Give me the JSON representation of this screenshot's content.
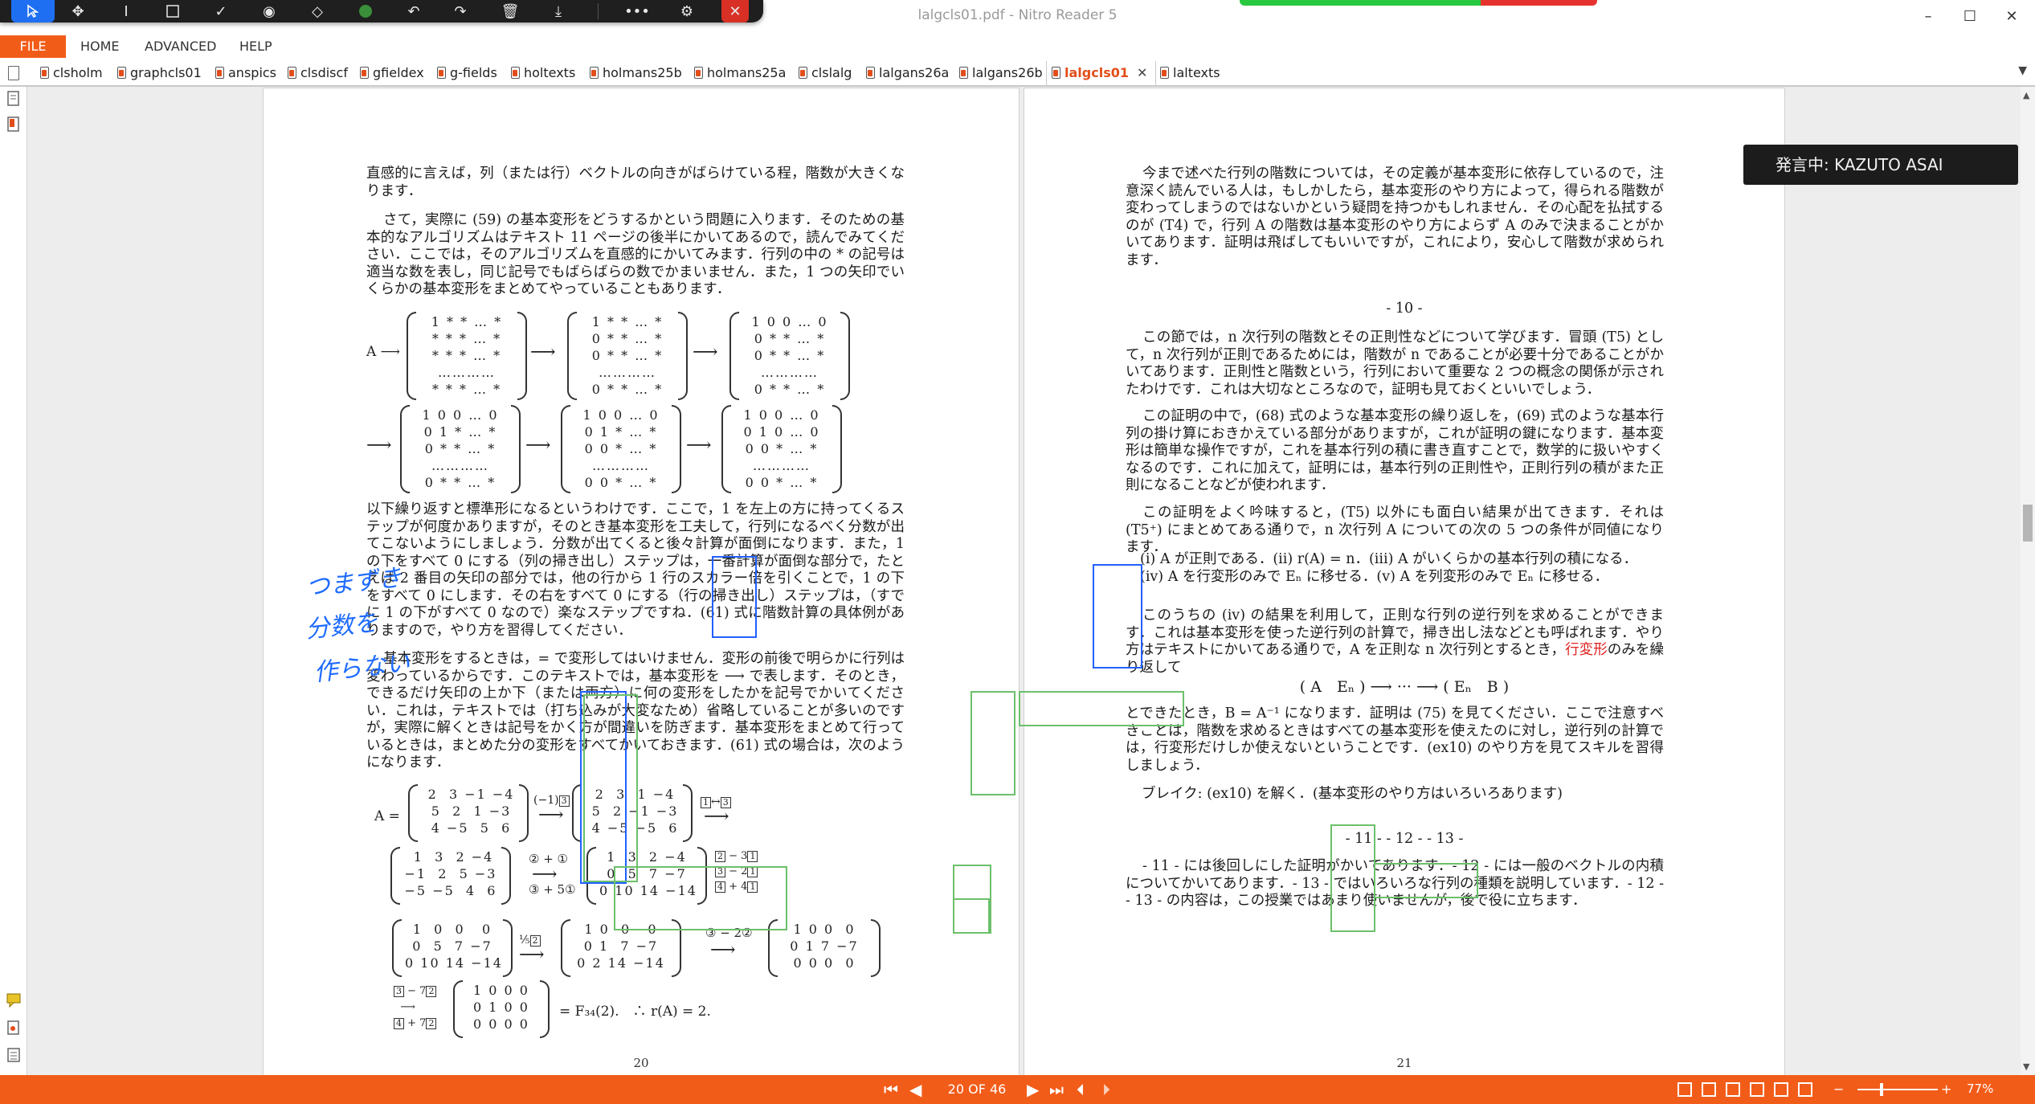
{
  "window": {
    "title": "lalgcls01.pdf - Nitro Reader 5",
    "minimize": "–",
    "maximize": "☐",
    "close": "✕"
  },
  "annotation_toolbar": {
    "tools": [
      "select-pointer",
      "move",
      "text-cursor",
      "rectangle",
      "checkmark",
      "stamp",
      "eraser",
      "color-dot",
      "undo",
      "redo",
      "delete",
      "download",
      "more",
      "user-settings",
      "close"
    ],
    "accent": "#1e6ff2"
  },
  "menu": {
    "file": "FILE",
    "home": "HOME",
    "advanced": "ADVANCED",
    "help": "HELP"
  },
  "tabs": [
    {
      "label": "clsholm"
    },
    {
      "label": "graphcls01"
    },
    {
      "label": "anspics"
    },
    {
      "label": "clsdiscf"
    },
    {
      "label": "gfieldex"
    },
    {
      "label": "g-fields"
    },
    {
      "label": "holtexts"
    },
    {
      "label": "holmans25b"
    },
    {
      "label": "holmans25a"
    },
    {
      "label": "clslalg"
    },
    {
      "label": "lalgans26a"
    },
    {
      "label": "lalgans26b"
    },
    {
      "label": "lalgcls01",
      "active": true
    },
    {
      "label": "laltexts"
    }
  ],
  "speaker_badge": "発言中: KAZUTO ASAI",
  "left_page": {
    "p1": "直感的に言えば，列（または行）ベクトルの向きがばらけている程，階数が大きくなります．",
    "p2": "さて，実際に (59) の基本変形をどうするかという問題に入ります．そのための基本的なアルゴリズムはテキスト 11 ページの後半にかいてあるので，読んでみてください．ここでは，そのアルゴリズムを直感的にかいてみます．行列の中の * の記号は適当な数を表し，同じ記号でもばらばらの数でかまいません．また，1 つの矢印でいくらかの基本変形をまとめてやっていることもあります．",
    "p3": "以下繰り返すと標準形になるというわけです．ここで，1 を左上の方に持ってくるステップが何度かありますが，そのとき基本変形を工夫して，行列になるべく分数が出てこないようにしましょう．分数が出てくると後々計算が面倒になります．また，1 の下をすべて 0 にする（列の掃き出し）ステップは，一番計算が面倒な部分で，たとえば 2 番目の矢印の部分では，他の行から 1 行のスカラー倍を引くことで，1 の下をすべて 0 にします．その右をすべて 0 にする（行の掃き出し）ステップは，（すでに 1 の下がすべて 0 なので）楽なステップですね．(61) 式に階数計算の具体例がありますので，やり方を習得してください．",
    "p4": "基本変形をするときは，= で変形してはいけません．変形の前後で明らかに行列は変わっているからです．このテキストでは，基本変形を ⟶ で表します．そのとき，できるだけ矢印の上か下（または両方）に何の変形をしたかを記号でかいてください．これは，テキストでは（打ち込みが大変なため）省略していることが多いのですが，実際に解くときは記号をかく方が間違いを防ぎます．基本変形をまとめて行っているときは，まとめた分の変形をすべてかいておきます．(61) 式の場合は，次のようになります．",
    "result_line": "= F₃₄(2).　∴ r(A) = 2.",
    "page_number": "20"
  },
  "right_page": {
    "p1": "今まで述べた行列の階数については，その定義が基本変形に依存しているので，注意深く読んでいる人は，もしかしたら，基本変形のやり方によって，得られる階数が変わってしまうのではないかという疑問を持つかもしれません．その心配を払拭するのが (T4) で，行列 A の階数は基本変形のやり方によらず A のみで決まることがかいてあります．証明は飛ばしてもいいですが，これにより，安心して階数が求められます．",
    "section": "- 10 -",
    "p2": "この節では，n 次行列の階数とその正則性などについて学びます．冒頭 (T5) として，n 次行列が正則であるためには，階数が n であることが必要十分であることがかいてあります．正則性と階数という，行列において重要な 2 つの概念の関係が示されたわけです．これは大切なところなので，証明も見ておくといいでしょう．",
    "p3": "この証明の中で，(68) 式のような基本変形の繰り返しを，(69) 式のような基本行列の掛け算におきかえている部分がありますが，これが証明の鍵になります．基本変形は簡単な操作ですが，これを基本行列の積に書き直すことで，数学的に扱いやすくなるのです．これに加えて，証明には，基本行列の正則性や，正則行列の積がまた正則になることなどが使われます．",
    "p4": "この証明をよく吟味すると，(T5) 以外にも面白い結果が出てきます．それは (T5⁺) にまとめてある通りで，n 次行列 A についての次の 5 つの条件が同値になります．",
    "cond1": "(i) A が正則である．(ii) r(A) = n．(iii) A がいくらかの基本行列の積になる．",
    "cond2": "(iv) A を行変形のみで Eₙ に移せる．(v) A を列変形のみで Eₙ に移せる．",
    "p5_a": "このうちの (iv) の結果を利用して，正則な行列の逆行列を求めることができます．これは基本変形を使った逆行列の計算で，掃き出し法などとも呼ばれます．やり方はテキストにかいてある通りで，A を正則な n 次行列とするとき，",
    "p5_red": "行変形",
    "p5_b": "のみを繰り返して",
    "formula": "( A　Eₙ ) ⟶ ··· ⟶ ( Eₙ　B )",
    "p6": "とできたとき，B = A⁻¹ になります．証明は (75) を見てください．ここで注意すべきことは，階数を求めるときはすべての基本変形を使えたのに対し，逆行列の計算では，行変形だけしか使えないということです．(ex10) のやり方を見てスキルを習得しましょう．",
    "p7": "ブレイク: (ex10) を解く．(基本変形のやり方はいろいろあります)",
    "section2": "- 11 - - 12 - - 13 -",
    "p8": "- 11 - には後回しにした証明がかいてあります．- 12 - には一般のベクトルの内積についてかいてあります．- 13 - ではいろいろな行列の種類を説明しています．- 12 - - 13 - の内容は，この授業ではあまり使いませんが，後で役に立ちます．",
    "page_number": "21",
    "red_color": "#e02020"
  },
  "handwriting": [
    "つまずき",
    "分数を",
    "作らない"
  ],
  "status": {
    "page_display": "20 OF 46",
    "zoom": "77%",
    "accent": "#f25c19"
  }
}
